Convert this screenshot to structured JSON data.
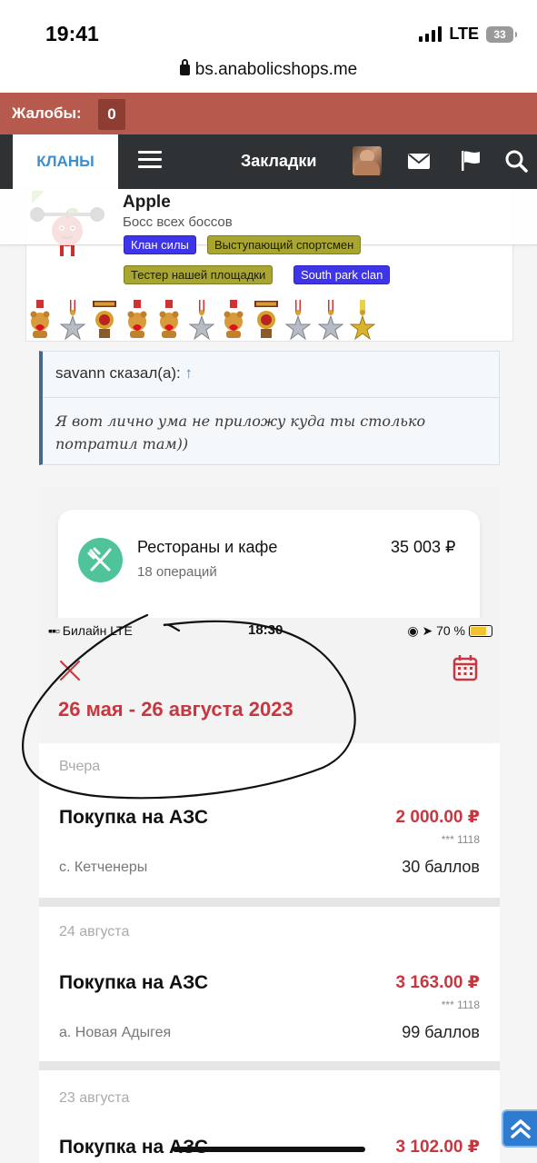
{
  "status_bar": {
    "time": "19:41",
    "network": "LTE",
    "battery": "33"
  },
  "browser": {
    "url": "bs.anabolicshops.me"
  },
  "complaints": {
    "label": "Жалобы:",
    "count": "0"
  },
  "nav": {
    "clans": "КЛАНЫ",
    "bookmarks": "Закладки",
    "icons": [
      "menu-icon",
      "user-avatar",
      "mail-icon",
      "flag-icon",
      "search-icon"
    ]
  },
  "post": {
    "user_name": "Apple",
    "user_title": "Босс всех боссов",
    "badges": [
      "Клан силы",
      "Выступающий спортсмен",
      "Тестер нашей площадки",
      "South park clan"
    ],
    "medals_count": 11
  },
  "quote": {
    "author": "savann сказал(а):",
    "arrow": "↑",
    "text": "Я вот лично ума не приложу куда ты столько потратил там))"
  },
  "embed": {
    "category": {
      "name": "Рестораны и кафе",
      "operations": "18 операций",
      "sum": "35 003 ₽"
    },
    "inner_status": {
      "carrier": "Билайн  LTE",
      "time": "18:30",
      "battery": "70 %"
    },
    "period": "26 мая - 26 августа 2023",
    "groups": [
      {
        "day": "Вчера",
        "name": "Покупка на АЗС",
        "amount": "2 000.00 ₽",
        "card": "*** 1118",
        "place": "с. Кетченеры",
        "points": "30 баллов"
      },
      {
        "day": "24 августа",
        "name": "Покупка на АЗС",
        "amount": "3 163.00 ₽",
        "card": "*** 1118",
        "place": "а. Новая Адыгея",
        "points": "99 баллов"
      },
      {
        "day": "23 августа",
        "name": "Покупка на АЗС",
        "amount": "3 102.00 ₽"
      }
    ]
  },
  "colors": {
    "complaints_bg": "#b55a4c",
    "nav_bg": "#2f3235",
    "accent_red": "#c8363f",
    "link_blue": "#3e8fd0",
    "badge_blue": "#3e34ea",
    "badge_olive": "#a8a630"
  }
}
